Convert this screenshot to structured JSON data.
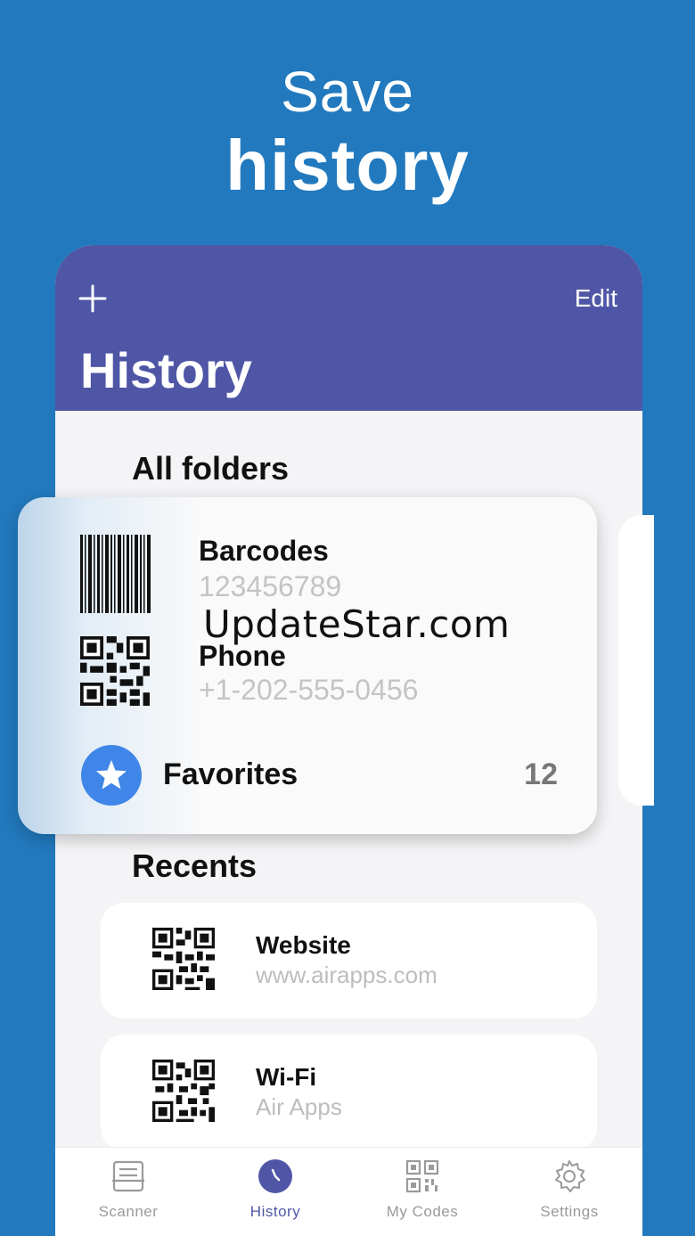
{
  "promo": {
    "line1": "Save",
    "line2": "history"
  },
  "header": {
    "title": "History",
    "edit_label": "Edit",
    "add_icon": "plus-icon"
  },
  "sections": {
    "folders_title": "All folders",
    "recents_title": "Recents"
  },
  "folders": [
    {
      "title": "Barcodes",
      "subtitle": "123456789",
      "icon": "barcode-icon"
    },
    {
      "title": "Phone",
      "subtitle": "+1-202-555-0456",
      "icon": "qr-code-icon"
    }
  ],
  "favorites": {
    "label": "Favorites",
    "count": "12",
    "icon": "star-icon",
    "color": "#3f86e8"
  },
  "watermark": "UpdateStar.com",
  "recents": [
    {
      "title": "Website",
      "subtitle": "www.airapps.com",
      "icon": "qr-code-icon"
    },
    {
      "title": "Wi-Fi",
      "subtitle": "Air Apps",
      "icon": "qr-code-icon"
    }
  ],
  "tabs": [
    {
      "label": "Scanner",
      "icon": "scanner-icon",
      "active": false
    },
    {
      "label": "History",
      "icon": "clock-icon",
      "active": true
    },
    {
      "label": "My Codes",
      "icon": "qr-grid-icon",
      "active": false
    },
    {
      "label": "Settings",
      "icon": "gear-icon",
      "active": false
    }
  ],
  "colors": {
    "background": "#2279bd",
    "header": "#4f56a6",
    "accent": "#4f56a6",
    "star": "#3f86e8"
  }
}
